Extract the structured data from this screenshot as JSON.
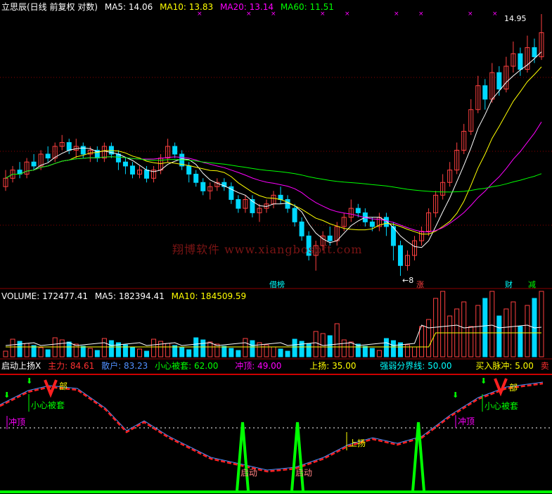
{
  "header": {
    "title": "立思辰(日线 前复权 对数)",
    "ma5": "MA5: 14.06",
    "ma10": "MA10: 13.83",
    "ma20": "MA20: 13.14",
    "ma60": "MA60: 11.51"
  },
  "volume_header": {
    "volume": "VOLUME: 172477.41",
    "ma5": "MA5: 182394.41",
    "ma10": "MA10: 184509.59"
  },
  "indicator_header": {
    "name": "启动上扬X",
    "zhuli": "主力: 84.61",
    "sanhu": "散户: 83.23",
    "xiaoxin": "小心被套: 62.00",
    "chongding": "冲顶: 49.00",
    "shangyang": "上扬: 35.00",
    "qiangruo": "强弱分界线: 50.00",
    "mairu": "买入脉冲: 5.00",
    "mai": "卖"
  },
  "watermark": "翔博软件 www.xiangbosoft.com",
  "labels": {
    "high": "14.95",
    "low": "8",
    "tag_ying": "借榜",
    "tag_zhang": "涨",
    "tag_cai": "财",
    "tag_jian": "减",
    "bu1": "部",
    "bu2": "部",
    "xiaoxin1": "小心被套",
    "xiaoxin2": "小心被套",
    "chongding1": "冲顶",
    "chongding2": "冲顶",
    "qidong1": "启动",
    "qidong2": "启动",
    "shangyang": "上扬"
  },
  "colors": {
    "up": "#ff4040",
    "down": "#00d8ff",
    "ma5": "#ffffff",
    "ma10": "#ffff00",
    "ma20": "#ff00ff",
    "ma60": "#00ff00",
    "grid": "#8b0000",
    "zhuli": "#ff2020",
    "sanhu": "#5090ff",
    "pulse": "#00ff00"
  },
  "chart_data": {
    "type": "candlestick",
    "price_range": [
      8,
      14.95
    ],
    "candles": [
      [
        9.9,
        10.1,
        10.3,
        9.8
      ],
      [
        10.1,
        10.3,
        10.4,
        10.0
      ],
      [
        10.3,
        10.2,
        10.5,
        10.1
      ],
      [
        10.2,
        10.5,
        10.6,
        10.1
      ],
      [
        10.5,
        10.4,
        10.7,
        10.3
      ],
      [
        10.4,
        10.7,
        10.8,
        10.3
      ],
      [
        10.7,
        10.6,
        10.9,
        10.5
      ],
      [
        10.6,
        10.9,
        11.0,
        10.5
      ],
      [
        10.9,
        11.0,
        11.2,
        10.8
      ],
      [
        11.0,
        10.8,
        11.1,
        10.7
      ],
      [
        10.8,
        10.9,
        11.1,
        10.6
      ],
      [
        10.9,
        10.7,
        11.0,
        10.6
      ],
      [
        10.7,
        10.8,
        10.9,
        10.5
      ],
      [
        10.8,
        10.6,
        10.9,
        10.5
      ],
      [
        10.6,
        10.9,
        11.0,
        10.5
      ],
      [
        10.9,
        10.7,
        11.0,
        10.6
      ],
      [
        10.7,
        10.5,
        10.8,
        10.3
      ],
      [
        10.5,
        10.4,
        10.6,
        10.2
      ],
      [
        10.4,
        10.2,
        10.5,
        10.1
      ],
      [
        10.2,
        10.3,
        10.4,
        10.1
      ],
      [
        10.3,
        10.1,
        10.4,
        10.0
      ],
      [
        10.1,
        10.3,
        10.4,
        10.0
      ],
      [
        10.3,
        10.6,
        10.7,
        10.2
      ],
      [
        10.6,
        10.9,
        11.1,
        10.5
      ],
      [
        10.9,
        10.7,
        11.0,
        10.6
      ],
      [
        10.7,
        10.4,
        10.8,
        10.3
      ],
      [
        10.4,
        10.2,
        10.5,
        10.0
      ],
      [
        10.2,
        10.0,
        10.3,
        9.9
      ],
      [
        10.0,
        9.8,
        10.1,
        9.7
      ],
      [
        9.8,
        9.9,
        10.0,
        9.6
      ],
      [
        9.9,
        10.0,
        10.1,
        9.8
      ],
      [
        10.0,
        9.9,
        10.1,
        9.8
      ],
      [
        9.9,
        9.6,
        10.0,
        9.5
      ],
      [
        9.6,
        9.4,
        9.7,
        9.3
      ],
      [
        9.4,
        9.6,
        9.7,
        9.3
      ],
      [
        9.6,
        9.3,
        9.7,
        9.2
      ],
      [
        9.3,
        9.4,
        9.5,
        9.1
      ],
      [
        9.4,
        9.5,
        9.6,
        9.3
      ],
      [
        9.5,
        9.7,
        9.8,
        9.4
      ],
      [
        9.7,
        9.6,
        9.9,
        9.5
      ],
      [
        9.6,
        9.4,
        9.7,
        9.3
      ],
      [
        9.4,
        9.1,
        9.5,
        9.0
      ],
      [
        9.1,
        8.8,
        9.2,
        8.7
      ],
      [
        8.8,
        8.4,
        8.9,
        8.3
      ],
      [
        8.4,
        8.6,
        8.7,
        8.1
      ],
      [
        8.6,
        8.8,
        8.9,
        8.5
      ],
      [
        8.8,
        8.7,
        9.0,
        8.6
      ],
      [
        8.7,
        9.0,
        9.1,
        8.6
      ],
      [
        9.0,
        9.2,
        9.3,
        8.9
      ],
      [
        9.2,
        9.4,
        9.6,
        9.1
      ],
      [
        9.4,
        9.3,
        9.5,
        9.2
      ],
      [
        9.3,
        9.1,
        9.4,
        9.0
      ],
      [
        9.1,
        9.0,
        9.2,
        8.9
      ],
      [
        9.0,
        9.2,
        9.3,
        8.9
      ],
      [
        9.2,
        9.0,
        9.3,
        8.8
      ],
      [
        9.0,
        8.6,
        9.1,
        8.3
      ],
      [
        8.6,
        8.2,
        8.7,
        8.0
      ],
      [
        8.2,
        8.4,
        8.5,
        8.1
      ],
      [
        8.4,
        8.7,
        8.8,
        8.3
      ],
      [
        8.7,
        8.9,
        9.0,
        8.6
      ],
      [
        8.9,
        9.3,
        9.4,
        8.8
      ],
      [
        9.3,
        9.7,
        9.8,
        9.2
      ],
      [
        9.7,
        10.0,
        10.2,
        9.6
      ],
      [
        10.0,
        10.3,
        10.5,
        9.9
      ],
      [
        10.3,
        10.8,
        11.0,
        10.2
      ],
      [
        10.8,
        11.3,
        11.5,
        10.7
      ],
      [
        11.3,
        11.9,
        12.2,
        11.2
      ],
      [
        11.9,
        12.6,
        12.9,
        11.8
      ],
      [
        12.6,
        12.2,
        12.8,
        11.9
      ],
      [
        12.2,
        13.0,
        13.3,
        12.1
      ],
      [
        13.0,
        12.5,
        13.2,
        12.3
      ],
      [
        12.5,
        13.2,
        13.5,
        12.4
      ],
      [
        13.2,
        13.6,
        14.0,
        13.0
      ],
      [
        13.6,
        13.1,
        13.8,
        12.9
      ],
      [
        13.1,
        13.8,
        14.2,
        13.0
      ],
      [
        13.8,
        13.5,
        14.1,
        13.3
      ],
      [
        13.5,
        14.3,
        14.95,
        13.4
      ]
    ],
    "indicator": {
      "zhuli": 84.61,
      "sanhu": 83.23,
      "xiaoxin_beitao": 62.0,
      "chongding": 49.0,
      "shangyang": 35.0,
      "qiangruo_fenjie": 50.0,
      "mairu_maichong": 5.0
    }
  }
}
